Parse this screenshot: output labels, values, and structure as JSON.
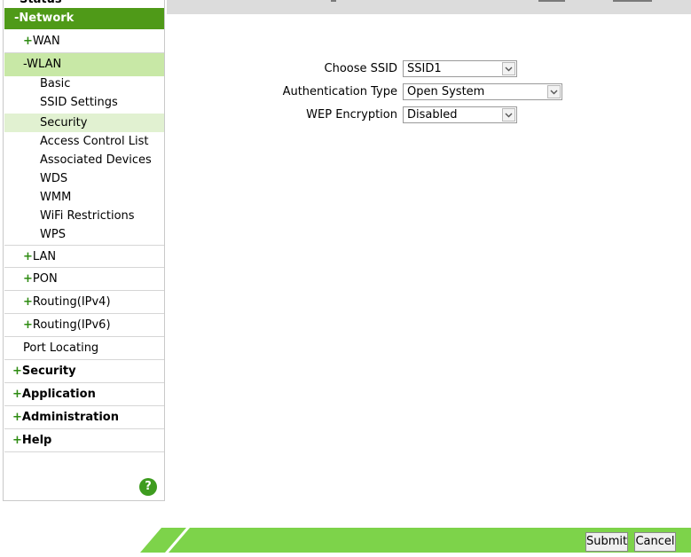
{
  "sidebar": {
    "network_header": "-Network",
    "items": [
      {
        "prefix": "+",
        "label": "WAN"
      },
      {
        "prefix": "-",
        "label": "WLAN"
      }
    ],
    "wlan_leaves": [
      "Basic",
      "SSID Settings",
      "Security",
      "Access Control List",
      "Associated Devices",
      "WDS",
      "WMM",
      "WiFi Restrictions",
      "WPS"
    ],
    "network_more": [
      {
        "prefix": "+",
        "label": "LAN"
      },
      {
        "prefix": "+",
        "label": "PON"
      },
      {
        "prefix": "+",
        "label": "Routing(IPv4)"
      },
      {
        "prefix": "+",
        "label": "Routing(IPv6)"
      },
      {
        "prefix": "",
        "label": "Port Locating"
      }
    ],
    "top_sections": [
      {
        "prefix": "+",
        "label": "Security"
      },
      {
        "prefix": "+",
        "label": "Application"
      },
      {
        "prefix": "+",
        "label": "Administration"
      },
      {
        "prefix": "+",
        "label": "Help"
      }
    ],
    "help_icon": "?"
  },
  "form": {
    "choose_ssid": {
      "label": "Choose SSID",
      "value": "SSID1"
    },
    "auth_type": {
      "label": "Authentication Type",
      "value": "Open System"
    },
    "wep_encryption": {
      "label": "WEP Encryption",
      "value": "Disabled"
    }
  },
  "buttons": {
    "submit": "Submit",
    "cancel": "Cancel"
  },
  "colors": {
    "accent_green": "#4f9a18",
    "active_row": "#c8e8a6",
    "bottom_bar": "#7dd34a"
  }
}
